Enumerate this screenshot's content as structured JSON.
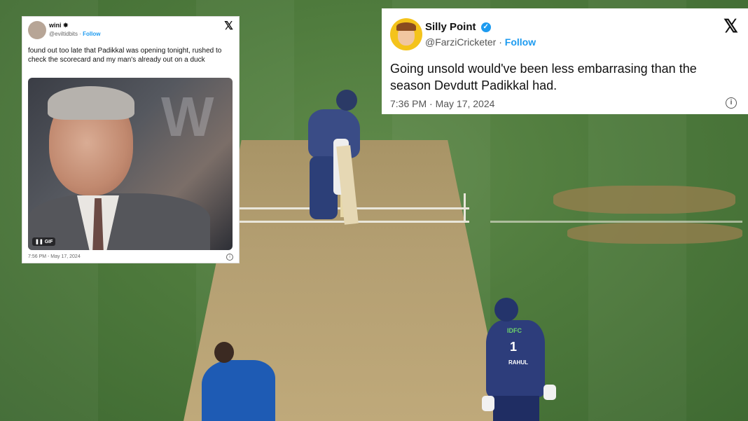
{
  "tweet_left": {
    "name": "wini",
    "name_suffix": "✸",
    "handle": "@eviltidbits",
    "follow": "Follow",
    "x_logo": "𝕏",
    "text": "found out too late that Padikkal was opening tonight, rushed to check the scorecard and my man's already out on a duck",
    "media_label": "GIF",
    "media_pause": "❚❚",
    "timestamp": "7:56 PM - May 17, 2024",
    "info_icon": "i"
  },
  "tweet_right": {
    "name": "Silly Point",
    "verified_icon": "✓",
    "handle": "@FarziCricketer",
    "follow": "Follow",
    "x_logo": "𝕏",
    "text": "Going unsold would've been less embarrasing than the season Devdutt Padikkal had.",
    "timestamp": "7:36 PM · May 17, 2024",
    "info_icon": "i"
  },
  "scene": {
    "keeper_number": "1",
    "keeper_name": "RAHUL",
    "keeper_sponsor": "IDFC"
  },
  "colors": {
    "field_green": "#4f7b3d",
    "pitch_tan": "#b49f72",
    "follow_blue": "#1d9bf0",
    "jersey_navy": "#2d3d7b",
    "jersey_blue": "#1e5bb4"
  }
}
